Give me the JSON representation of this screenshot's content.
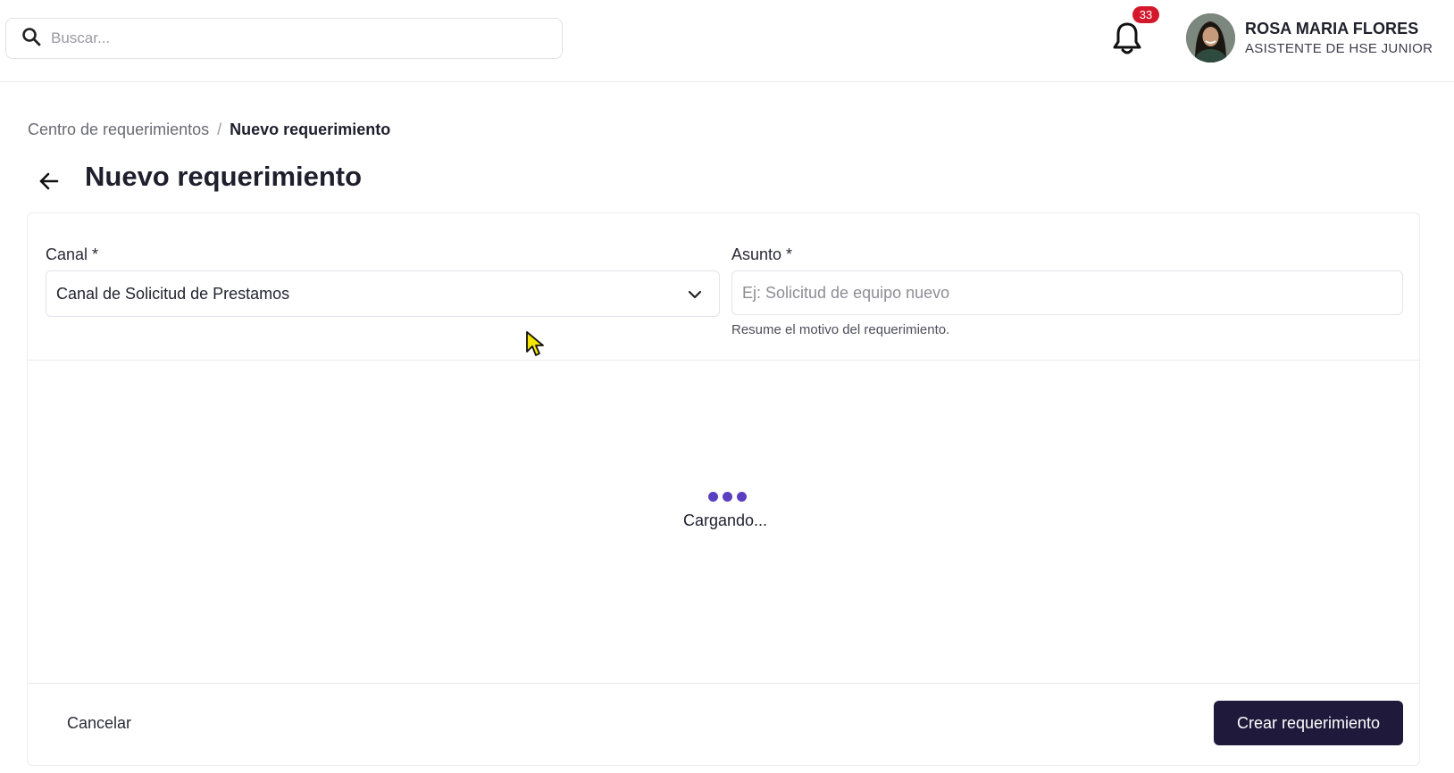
{
  "header": {
    "search_placeholder": "Buscar...",
    "notifications_count": "33",
    "user_name": "ROSA MARIA FLORES",
    "user_role": "ASISTENTE DE HSE JUNIOR",
    "accent_color": "#d3182c"
  },
  "breadcrumb": {
    "parent": "Centro de requerimientos",
    "separator": "/",
    "current": "Nuevo requerimiento"
  },
  "page": {
    "title": "Nuevo requerimiento"
  },
  "form": {
    "canal_label": "Canal *",
    "canal_value": "Canal de Solicitud de Prestamos",
    "asunto_label": "Asunto *",
    "asunto_placeholder": "Ej: Solicitud de equipo nuevo",
    "asunto_helper": "Resume el motivo del requerimiento.",
    "loading_text": "Cargando...",
    "loading_color": "#5a3fc0"
  },
  "footer": {
    "cancel_label": "Cancelar",
    "create_label": "Crear requerimiento",
    "primary_color": "#1f1a3b"
  },
  "icons": [
    "search-icon",
    "bell-icon",
    "back-arrow-icon",
    "chevron-down-icon",
    "mouse-cursor-icon"
  ]
}
